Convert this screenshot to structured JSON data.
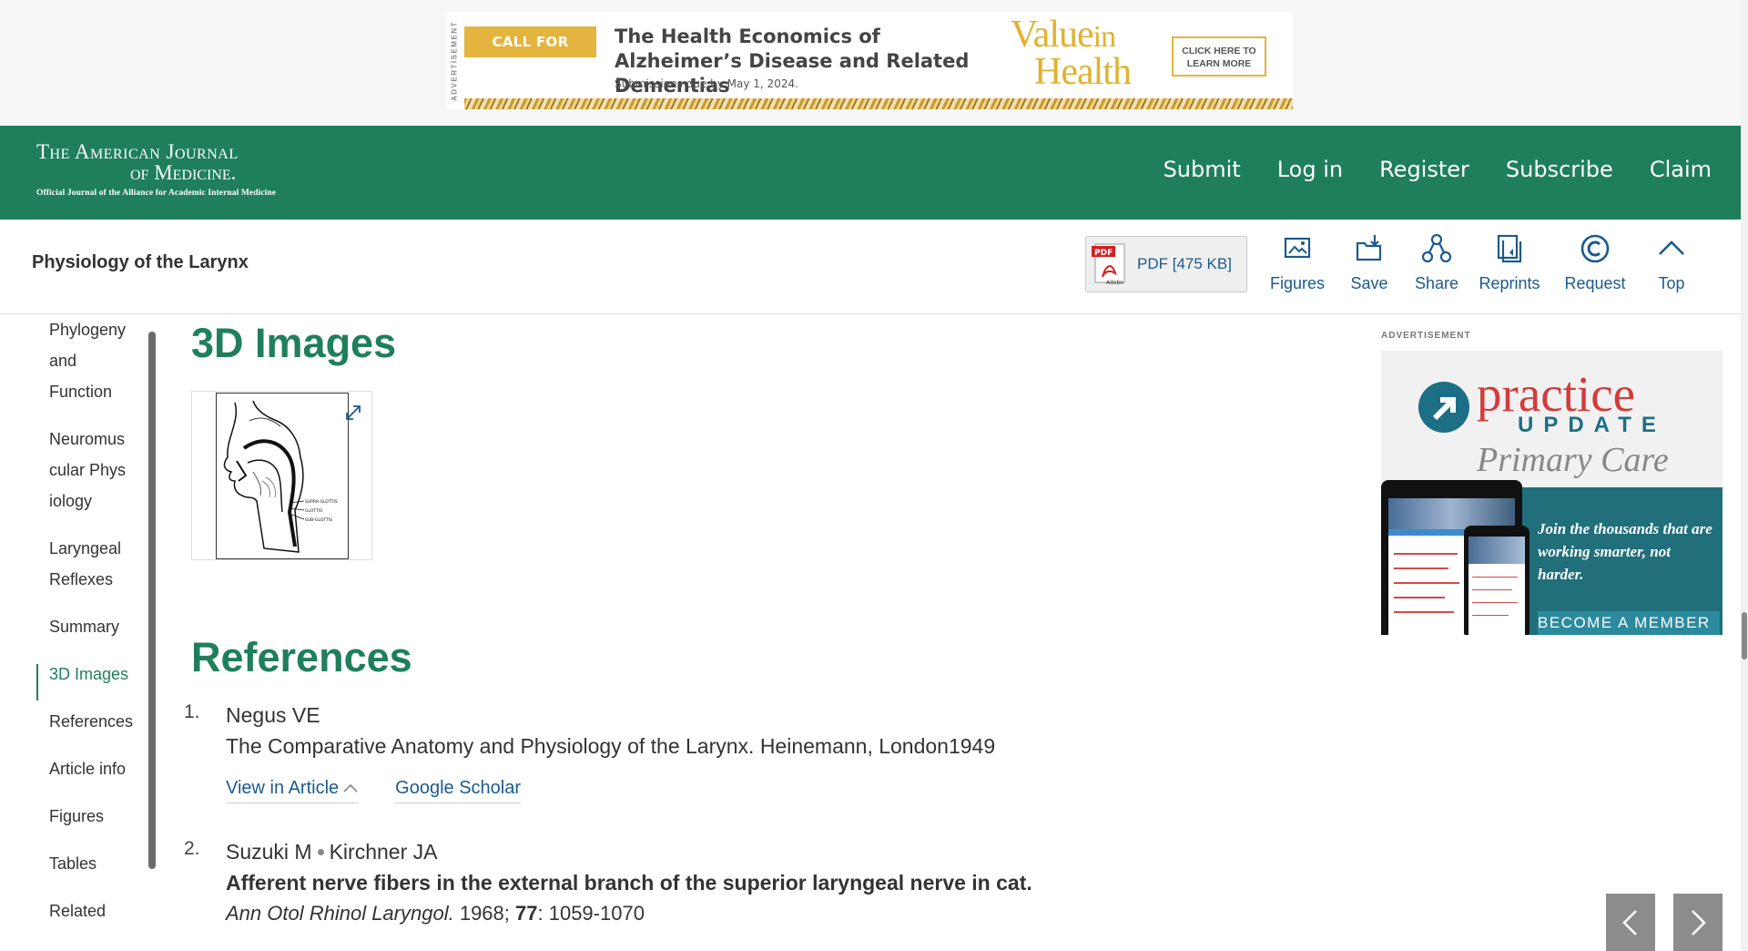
{
  "top_ad": {
    "vertical_label": "ADVERTISEMENT",
    "badge": "CALL FOR PAPERS",
    "headline": "The Health Economics of Alzheimer’s Disease and Related Dementias",
    "subline": "Submissions due by May 1, 2024.",
    "brand_line1": "Value",
    "brand_in": "in",
    "brand_line2": "Health",
    "cta": "CLICK HERE TO LEARN MORE",
    "accent_color": "#e3b53f"
  },
  "header": {
    "logo_line1": "The American Journal",
    "logo_line2": "of Medicine.",
    "logo_tagline": "Official Journal of the Alliance for Academic Internal Medicine",
    "nav": [
      "Submit",
      "Log in",
      "Register",
      "Subscribe",
      "Claim"
    ],
    "brand_color": "#1f7f5b"
  },
  "toolbar": {
    "article_title": "Physiology of the Larynx",
    "pdf_label": "PDF [475 KB]",
    "tools": [
      {
        "label": "Figures",
        "icon": "image-icon"
      },
      {
        "label": "Save",
        "icon": "folder-save-icon"
      },
      {
        "label": "Share",
        "icon": "share-nodes-icon"
      },
      {
        "label": "Reprints",
        "icon": "reprints-icon"
      },
      {
        "label": "Request",
        "icon": "copyright-icon"
      },
      {
        "label": "Top",
        "icon": "chevron-up-icon"
      }
    ]
  },
  "toc": {
    "items": [
      {
        "label": "Phylogeny and Function",
        "active": false
      },
      {
        "label": "Neuromuscular Physiology",
        "active": false
      },
      {
        "label": "Laryngeal Reflexes",
        "active": false
      },
      {
        "label": "Summary",
        "active": false
      },
      {
        "label": "3D Images",
        "active": true
      },
      {
        "label": "References",
        "active": false
      },
      {
        "label": "Article info",
        "active": false
      },
      {
        "label": "Figures",
        "active": false
      },
      {
        "label": "Tables",
        "active": false
      },
      {
        "label": "Related",
        "active": false
      }
    ]
  },
  "main": {
    "images_heading": "3D Images",
    "figure_labels": [
      "SUPRA-GLOTTIS",
      "GLOTTIS",
      "SUB-GLOTTIS"
    ],
    "references_heading": "References",
    "references": [
      {
        "num": "1.",
        "authors": "Negus VE",
        "title": "The Comparative Anatomy and Physiology of the Larynx. Heinemann, London1949",
        "links": [
          "View in Article",
          "Google Scholar"
        ]
      },
      {
        "num": "2.",
        "author_a": "Suzuki M",
        "author_b": "Kirchner JA",
        "title": "Afferent nerve fibers in the external branch of the superior laryngeal nerve in cat.",
        "journal": "Ann Otol Rhinol Laryngol.",
        "year": "1968;",
        "volume": "77",
        "pages": ": 1059-1070"
      }
    ]
  },
  "side_ad": {
    "label": "ADVERTISEMENT",
    "brand": "practice",
    "brand_sub": "UPDATE",
    "specialty": "Primary Care",
    "tagline": "Join the thousands that are working smarter, not harder.",
    "cta": "BECOME A MEMBER"
  }
}
